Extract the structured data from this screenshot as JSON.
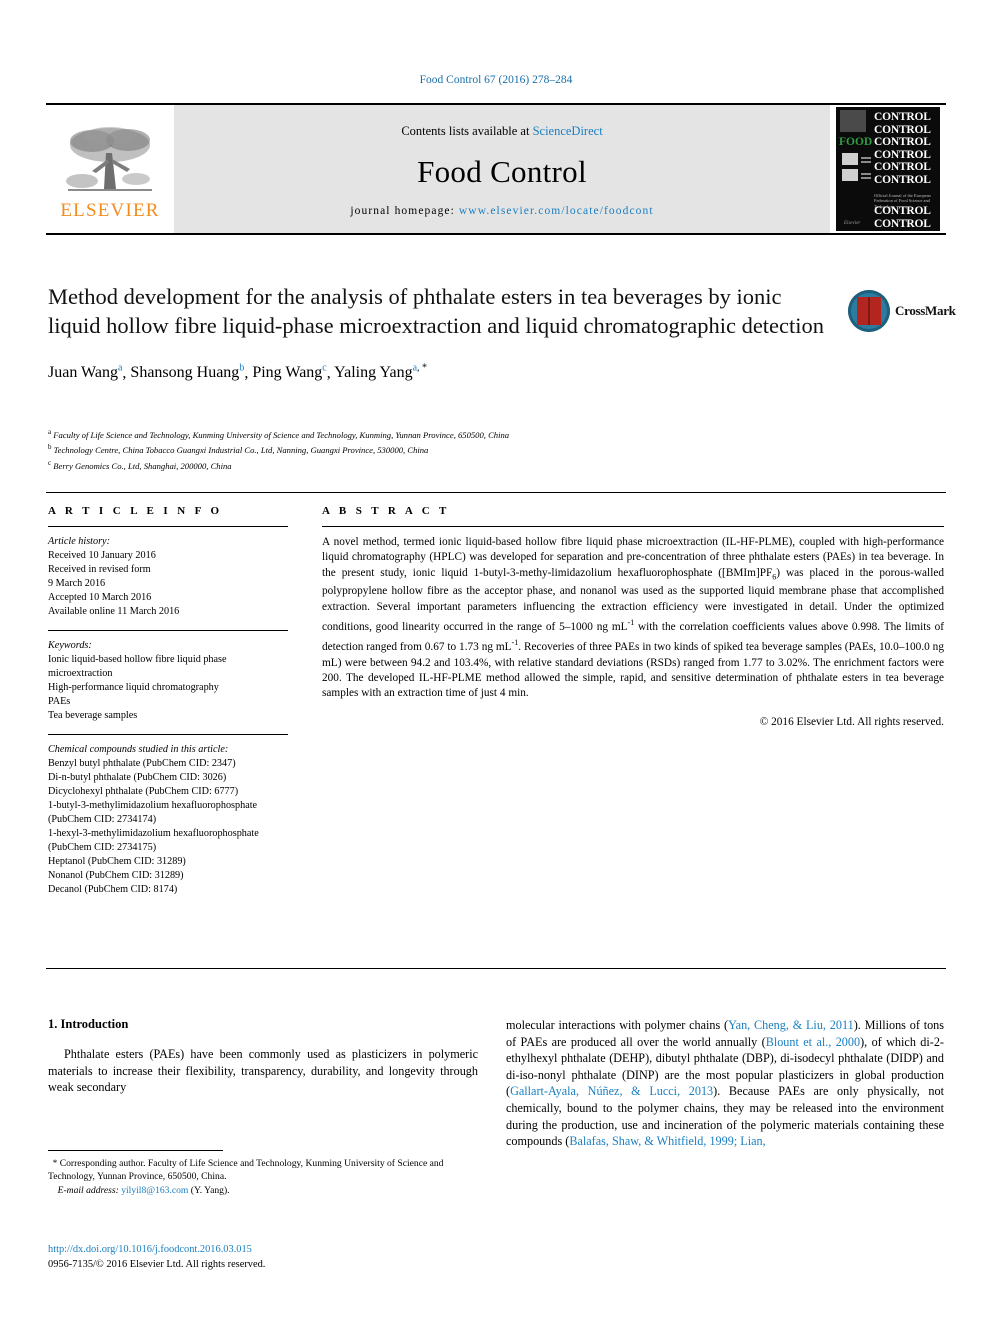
{
  "journal_ref": "Food Control 67 (2016) 278–284",
  "masthead": {
    "contents_prefix": "Contents lists available at ",
    "sciencedirect": "ScienceDirect",
    "journal_title": "Food Control",
    "homepage_label": "journal homepage: ",
    "homepage_url": "www.elsevier.com/locate/foodcont",
    "publisher_wordmark": "ELSEVIER",
    "cover": {
      "rows": [
        "CONTROL",
        "CONTROL",
        "CONTROL",
        "CONTROL",
        "CONTROL",
        "CONTROL",
        "CONTROL",
        "CONTROL",
        "CONTROL"
      ],
      "food_word": "FOOD",
      "tiny_text": "Official Journal of the European Federation of Food Science and Technology",
      "footer_word": "Elsevier"
    },
    "colors": {
      "link": "#1a7fc1",
      "elsevier_orange": "#F28C1E",
      "cover_green": "#2f9e44",
      "band_gray": "#e4e4e4"
    }
  },
  "title": "Method development for the analysis of phthalate esters in tea beverages by ionic liquid hollow fibre liquid-phase microextraction and liquid chromatographic detection",
  "crossmark_label": "CrossMark",
  "authors": [
    {
      "name": "Juan Wang",
      "marks": "a",
      "sep": ", "
    },
    {
      "name": "Shansong Huang",
      "marks": "b",
      "sep": ", "
    },
    {
      "name": "Ping Wang",
      "marks": "c",
      "sep": ", "
    },
    {
      "name": "Yaling Yang",
      "marks": "a",
      "star": true,
      "sep": ""
    }
  ],
  "affiliations": [
    {
      "mark": "a",
      "text": "Faculty of Life Science and Technology, Kunming University of Science and Technology, Kunming, Yunnan Province, 650500, China"
    },
    {
      "mark": "b",
      "text": "Technology Centre, China Tobacco Guangxi Industrial Co., Ltd, Nanning, Guangxi Province, 530000, China"
    },
    {
      "mark": "c",
      "text": "Berry Genomics Co., Ltd, Shanghai, 200000, China"
    }
  ],
  "article_info": {
    "heading": "A R T I C L E  I N F O",
    "history_label": "Article history:",
    "history": [
      "Received 10 January 2016",
      "Received in revised form",
      "9 March 2016",
      "Accepted 10 March 2016",
      "Available online 11 March 2016"
    ],
    "keywords_label": "Keywords:",
    "keywords": [
      "Ionic liquid-based hollow fibre liquid phase microextraction",
      "High-performance liquid chromatography",
      "PAEs",
      "Tea beverage samples"
    ],
    "compounds_label": "Chemical compounds studied in this article:",
    "compounds": [
      "Benzyl butyl phthalate (PubChem CID: 2347)",
      "Di-n-butyl phthalate (PubChem CID: 3026)",
      "Dicyclohexyl phthalate (PubChem CID: 6777)",
      "1-butyl-3-methylimidazolium hexafluorophosphate (PubChem CID: 2734174)",
      "1-hexyl-3-methylimidazolium hexafluorophosphate (PubChem CID: 2734175)",
      "Heptanol (PubChem CID: 31289)",
      "Nonanol (PubChem CID: 31289)",
      "Decanol (PubChem CID: 8174)"
    ]
  },
  "abstract": {
    "heading": "A B S T R A C T",
    "paragraph_parts": [
      "A novel method, termed ionic liquid-based hollow fibre liquid phase microextraction (IL-HF-PLME), coupled with high-performance liquid chromatography (HPLC) was developed for separation and pre-concentration of three phthalate esters (PAEs) in tea beverage. In the present study, ionic liquid 1-butyl-3-methy-limidazolium hexafluorophosphate ([BMIm]PF",
      "6",
      ") was placed in the porous-walled polypropylene hollow fibre as the acceptor phase, and nonanol was used as the supported liquid membrane phase that accomplished extraction. Several important parameters influencing the extraction efficiency were investigated in detail. Under the optimized conditions, good linearity occurred in the range of 5–1000 ng mL",
      "-1",
      " with the correlation coefficients values above 0.998. The limits of detection ranged from 0.67 to 1.73 ng mL",
      "-1",
      ". Recoveries of three PAEs in two kinds of spiked tea beverage samples (PAEs, 10.0–100.0 ng mL) were between 94.2 and 103.4%, with relative standard deviations (RSDs) ranged from 1.77 to 3.02%. The enrichment factors were 200. The developed IL-HF-PLME method allowed the simple, rapid, and sensitive determination of phthalate esters in tea beverage samples with an extraction time of just 4 min."
    ],
    "copyright": "© 2016 Elsevier Ltd. All rights reserved."
  },
  "introduction": {
    "heading": "1. Introduction",
    "left_paragraph": "Phthalate esters (PAEs) have been commonly used as plasticizers in polymeric materials to increase their flexibility, transparency, durability, and longevity through weak secondary",
    "right_parts": [
      {
        "t": "molecular interactions with polymer chains (",
        "cite": false
      },
      {
        "t": "Yan, Cheng, & Liu, 2011",
        "cite": true
      },
      {
        "t": "). Millions of tons of PAEs are produced all over the world annually (",
        "cite": false
      },
      {
        "t": "Blount et al., 2000",
        "cite": true
      },
      {
        "t": "), of which di-2-ethylhexyl phthalate (DEHP), dibutyl phthalate (DBP), di-isodecyl phthalate (DIDP) and di-iso-nonyl phthalate (DINP) are the most popular plasticizers in global production (",
        "cite": false
      },
      {
        "t": "Gallart-Ayala, Núñez, & Lucci, 2013",
        "cite": true
      },
      {
        "t": "). Because PAEs are only physically, not chemically, bound to the polymer chains, they may be released into the environment during the production, use and incineration of the polymeric materials containing these compounds (",
        "cite": false
      },
      {
        "t": "Balafas, Shaw, & Whitfield, 1999; Lian,",
        "cite": true
      }
    ]
  },
  "footnote": {
    "star": "*",
    "corresponding": " Corresponding author. Faculty of Life Science and Technology, Kunming University of Science and Technology, Yunnan Province, 650500, China.",
    "email_label": "E-mail address: ",
    "email": "yilyil8@163.com",
    "email_suffix": " (Y. Yang)."
  },
  "doi_block": {
    "doi": "http://dx.doi.org/10.1016/j.foodcont.2016.03.015",
    "issn_line": "0956-7135/© 2016 Elsevier Ltd. All rights reserved."
  }
}
